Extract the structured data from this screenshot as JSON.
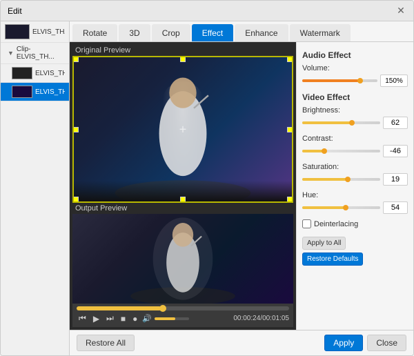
{
  "window": {
    "title": "Edit"
  },
  "tabs": [
    {
      "id": "rotate",
      "label": "Rotate",
      "active": false
    },
    {
      "id": "3d",
      "label": "3D",
      "active": false
    },
    {
      "id": "crop",
      "label": "Crop",
      "active": false
    },
    {
      "id": "effect",
      "label": "Effect",
      "active": true
    },
    {
      "id": "enhance",
      "label": "Enhance",
      "active": false
    },
    {
      "id": "watermark",
      "label": "Watermark",
      "active": false
    }
  ],
  "sidebar": {
    "items": [
      {
        "id": "item1",
        "label": "ELVIS_THATS_",
        "type": "file",
        "active": false,
        "indent": 0
      },
      {
        "id": "item2",
        "label": "Clip-ELVIS_TH...",
        "type": "clip",
        "active": false,
        "indent": 1
      },
      {
        "id": "item3",
        "label": "ELVIS_TH...",
        "type": "sub",
        "active": false,
        "indent": 2
      },
      {
        "id": "item4",
        "label": "ELVIS_THATS_",
        "type": "sub",
        "active": true,
        "indent": 2
      }
    ]
  },
  "preview": {
    "original_label": "Original Preview",
    "output_label": "Output Preview"
  },
  "controls": {
    "time_current": "00:00:24",
    "time_total": "00:01:05",
    "progress_percent": 40,
    "volume_percent": 60
  },
  "effects": {
    "audio_title": "Audio Effect",
    "volume_label": "Volume:",
    "volume_value": "150%",
    "video_title": "Video Effect",
    "brightness_label": "Brightness:",
    "brightness_value": "62",
    "contrast_label": "Contrast:",
    "contrast_value": "-46",
    "saturation_label": "Saturation:",
    "saturation_value": "19",
    "hue_label": "Hue:",
    "hue_value": "54",
    "deinterlacing_label": "Deinterlacing"
  },
  "buttons": {
    "apply_to_all": "Apply to All",
    "restore_defaults": "Restore Defaults",
    "restore_all": "Restore All",
    "apply": "Apply",
    "close": "Close"
  }
}
